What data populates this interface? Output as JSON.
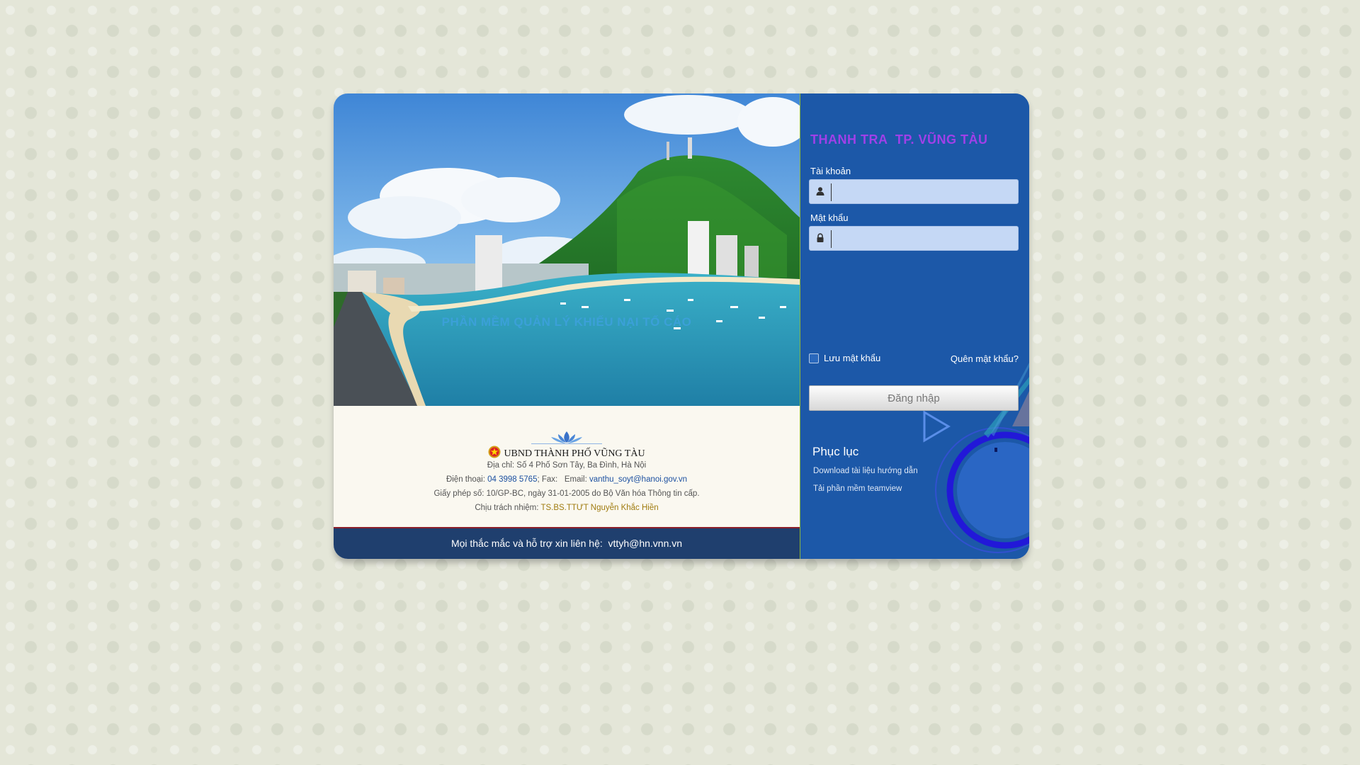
{
  "app": {
    "title": "PHẦN MỀM QUẢN LÝ KHIẾU NẠI TỐ CÁO",
    "org_name": "UBND THÀNH PHỐ VŨNG TÀU",
    "address": "Địa chỉ: Số 4 Phố Sơn Tây, Ba Đình, Hà Nội",
    "phone_label": "Điện thoại:",
    "phone": "04 3998 5765",
    "fax_email_label": "; Fax:   Email:",
    "email": "vanthu_soyt@hanoi.gov.vn",
    "license": "Giấy phép số: 10/GP-BC, ngày 31-01-2005 do Bộ Văn hóa Thông tin cấp.",
    "responsible_label": "Chịu trách nhiệm:",
    "responsible_name": "TS.BS.TTƯT Nguyễn Khắc Hiền",
    "footer_label": "Mọi thắc mắc và hỗ trợ xin liên hệ:",
    "footer_email": "vttyh@hn.vnn.vn"
  },
  "login": {
    "brand": "THANH TRA  TP. VŨNG TÀU",
    "username_label": "Tài khoản",
    "username_value": "",
    "password_label": "Mật khẩu",
    "password_value": "",
    "remember_label": "Lưu mật khẩu",
    "remember_checked": false,
    "forgot_label": "Quên mật khẩu?",
    "submit_label": "Đăng nhập"
  },
  "appendix": {
    "title": "Phục lục",
    "links": [
      "Download tài liệu hướng dẫn",
      "Tải phần mềm teamview"
    ]
  },
  "colors": {
    "panel_blue": "#1c58a8",
    "title_blue": "#3ba0d8",
    "brand_purple": "#a040e8",
    "footer_navy": "#1f3f6e"
  },
  "icons": {
    "username": "user-icon",
    "password": "lock-icon",
    "emblem": "national-emblem-icon",
    "lotus": "lotus-logo-icon"
  }
}
